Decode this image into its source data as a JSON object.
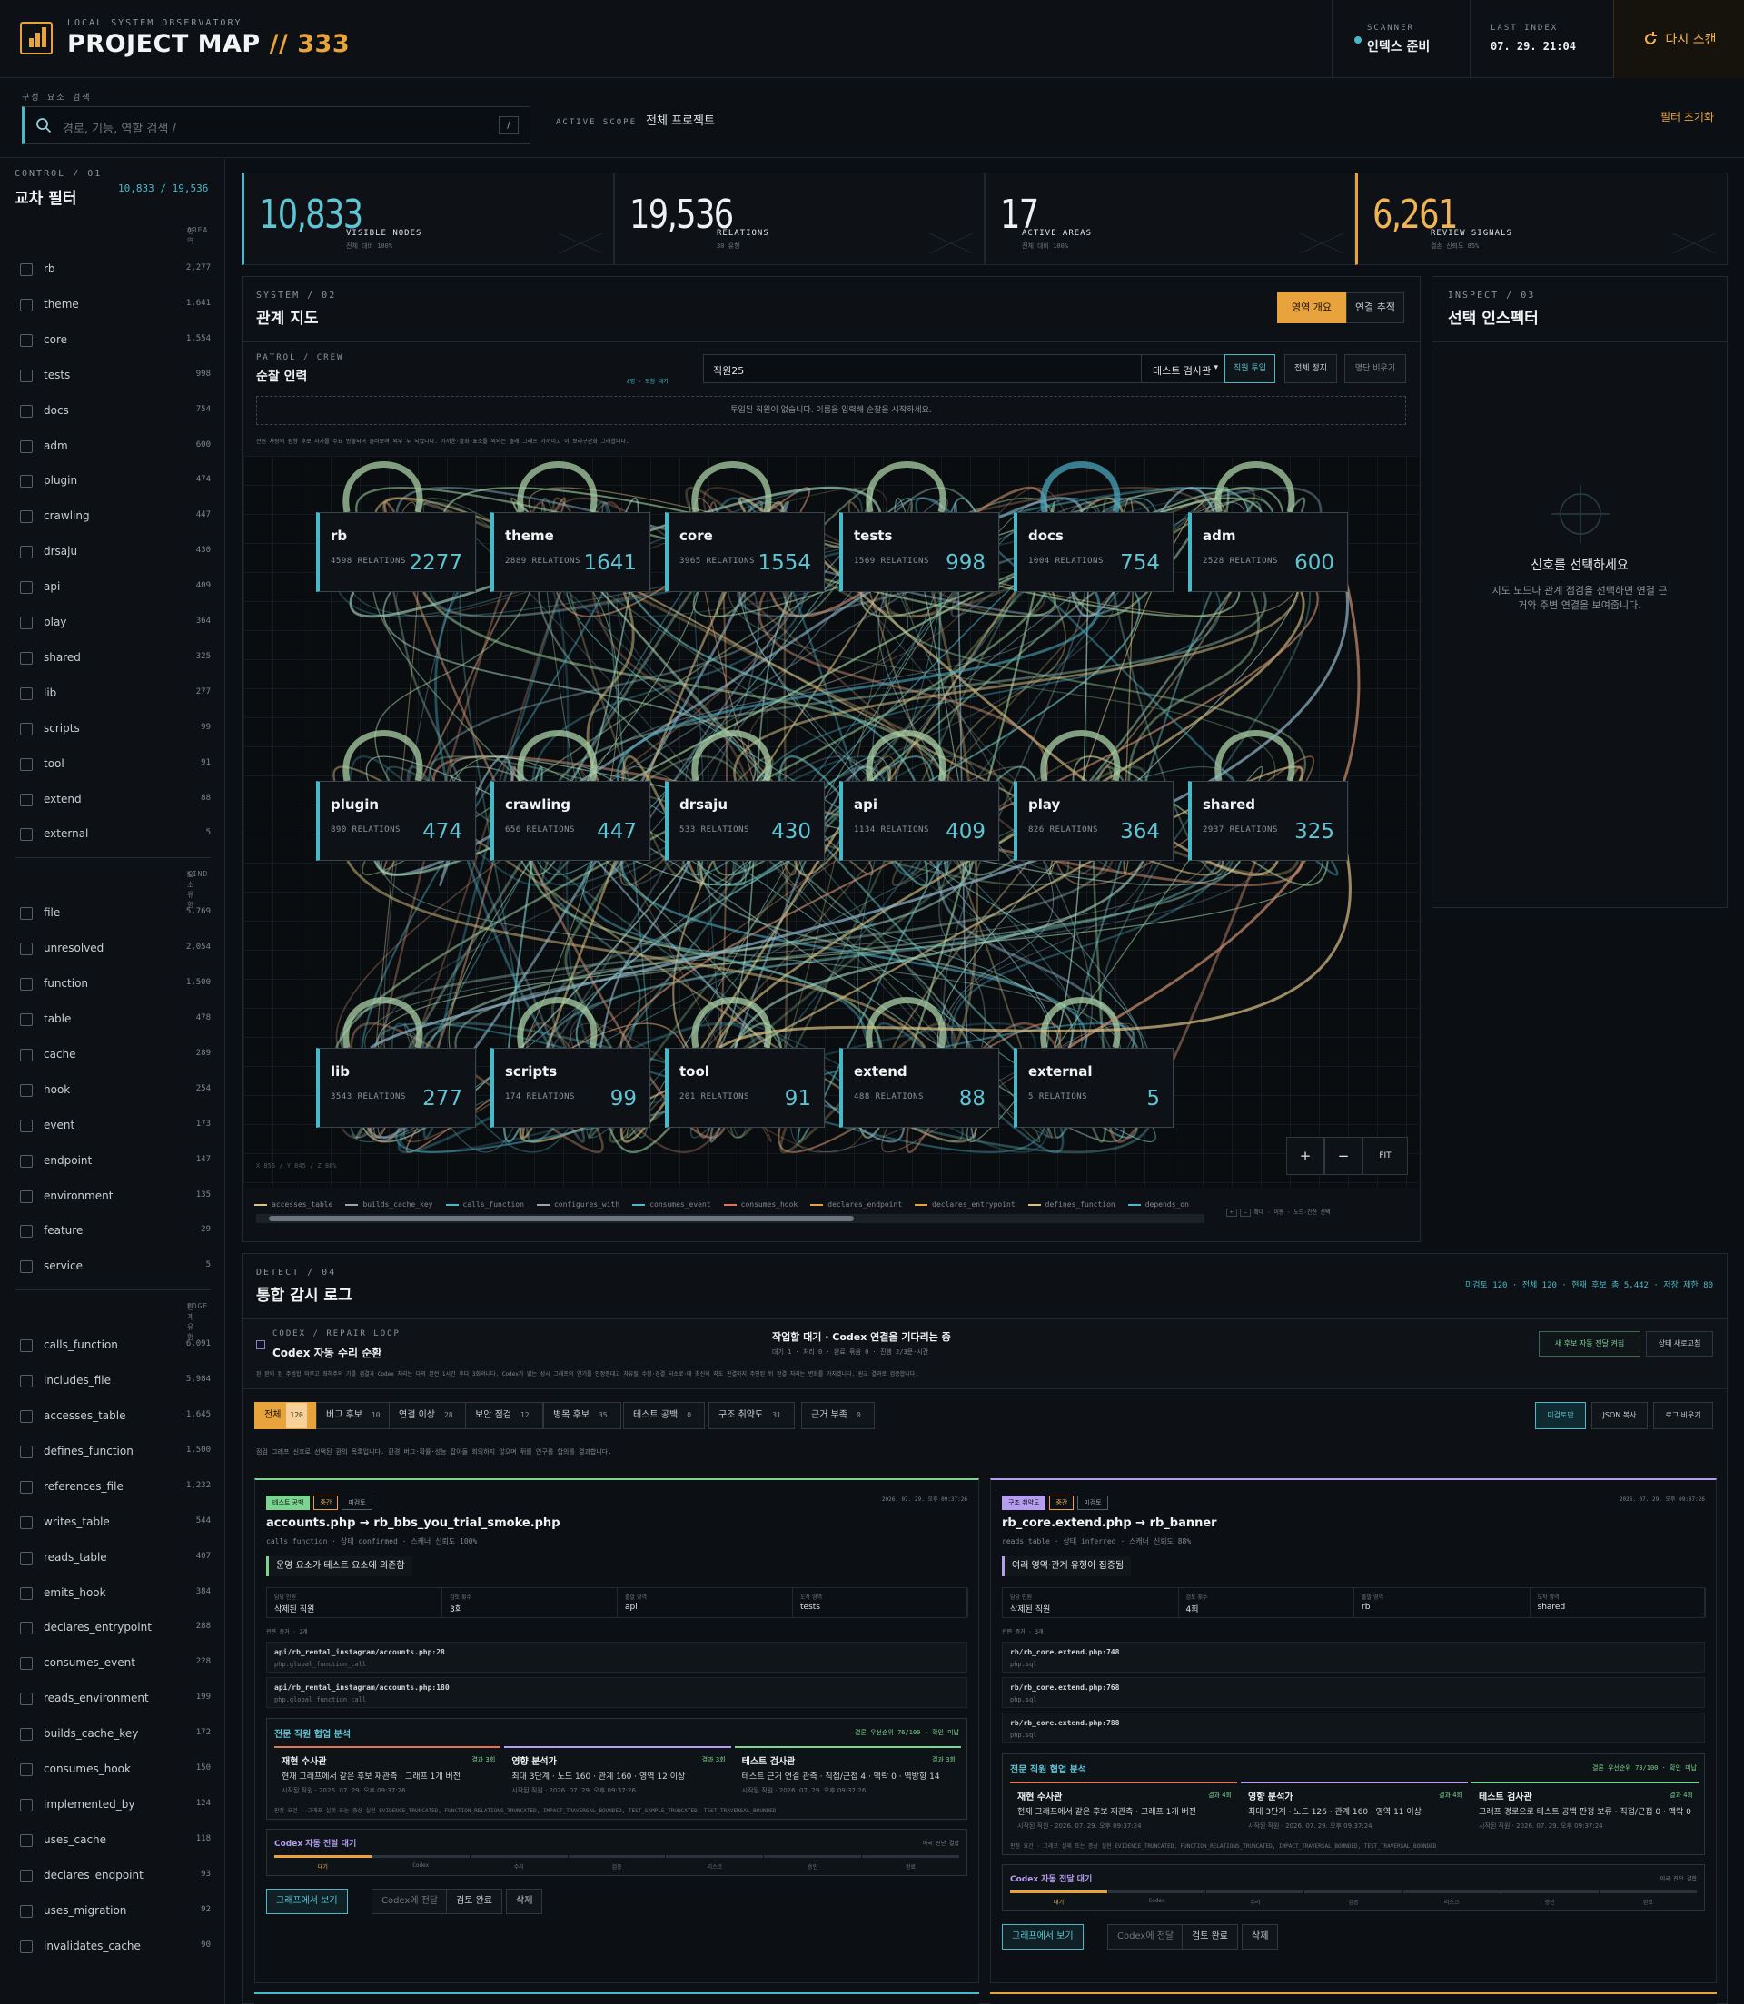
{
  "header": {
    "kicker": "LOCAL SYSTEM OBSERVATORY",
    "title": "PROJECT MAP",
    "title_sep": "//",
    "title_num": "333",
    "scanner_k": "SCANNER",
    "scanner_v": "인덱스 준비",
    "index_k": "LAST INDEX",
    "index_v": "07. 29. 21:04",
    "rescan": "다시 스캔"
  },
  "search": {
    "kicker": "구성 요소 검색",
    "placeholder": "경로, 기능, 역할 검색  /",
    "key": "/",
    "scope_k": "ACTIVE SCOPE",
    "scope_v": "전체 프로젝트",
    "reset": "필터 초기화"
  },
  "sidebar": {
    "kicker": "CONTROL / 01",
    "title": "교차 필터",
    "count": "10,833 / 19,536",
    "area_h": "영역",
    "area_k": "AREA",
    "areas": [
      [
        "rb",
        "2,277"
      ],
      [
        "theme",
        "1,641"
      ],
      [
        "core",
        "1,554"
      ],
      [
        "tests",
        "998"
      ],
      [
        "docs",
        "754"
      ],
      [
        "adm",
        "600"
      ],
      [
        "plugin",
        "474"
      ],
      [
        "crawling",
        "447"
      ],
      [
        "drsaju",
        "430"
      ],
      [
        "api",
        "409"
      ],
      [
        "play",
        "364"
      ],
      [
        "shared",
        "325"
      ],
      [
        "lib",
        "277"
      ],
      [
        "scripts",
        "99"
      ],
      [
        "tool",
        "91"
      ],
      [
        "extend",
        "88"
      ],
      [
        "external",
        "5"
      ]
    ],
    "kind_h": "요소 유형",
    "kind_k": "KIND",
    "kinds": [
      [
        "file",
        "5,769"
      ],
      [
        "unresolved",
        "2,054"
      ],
      [
        "function",
        "1,500"
      ],
      [
        "table",
        "478"
      ],
      [
        "cache",
        "289"
      ],
      [
        "hook",
        "254"
      ],
      [
        "event",
        "173"
      ],
      [
        "endpoint",
        "147"
      ],
      [
        "environment",
        "135"
      ],
      [
        "feature",
        "29"
      ],
      [
        "service",
        "5"
      ]
    ],
    "edge_h": "관계 유형",
    "edge_k": "EDGE",
    "edges": [
      [
        "calls_function",
        "6,091"
      ],
      [
        "includes_file",
        "5,984"
      ],
      [
        "accesses_table",
        "1,645"
      ],
      [
        "defines_function",
        "1,500"
      ],
      [
        "references_file",
        "1,232"
      ],
      [
        "writes_table",
        "544"
      ],
      [
        "reads_table",
        "407"
      ],
      [
        "emits_hook",
        "384"
      ],
      [
        "declares_entrypoint",
        "288"
      ],
      [
        "consumes_event",
        "228"
      ],
      [
        "reads_environment",
        "199"
      ],
      [
        "builds_cache_key",
        "172"
      ],
      [
        "consumes_hook",
        "150"
      ],
      [
        "implemented_by",
        "124"
      ],
      [
        "uses_cache",
        "118"
      ],
      [
        "declares_endpoint",
        "93"
      ],
      [
        "uses_migration",
        "92"
      ],
      [
        "invalidates_cache",
        "90"
      ]
    ]
  },
  "stats": [
    {
      "num": "10,833",
      "lbl": "VISIBLE NODES",
      "sub": "전체 대비 100%"
    },
    {
      "num": "19,536",
      "lbl": "RELATIONS",
      "sub": "30 유형"
    },
    {
      "num": "17",
      "lbl": "ACTIVE AREAS",
      "sub": "전체 대비 100%"
    },
    {
      "num": "6,261",
      "lbl": "REVIEW SIGNALS",
      "sub": "결손 신뢰도 85%"
    }
  ],
  "system": {
    "kicker": "SYSTEM / 02",
    "title": "관계 지도",
    "btn_overview": "영역 개요",
    "btn_trace": "연결 추적",
    "patrol_k": "PATROL / CREW",
    "patrol_t": "순찰 인력",
    "patrol_note": "8명 · 모험 대기",
    "staff_input": "직원25",
    "role_select": "테스트 검사관",
    "btn_add": "직원 투입",
    "btn_stop": "전체 정지",
    "btn_clear": "명단 비우기",
    "empty_msg": "투입된 직원이 없습니다. 이름을 입력해 순찰을 시작하세요.",
    "help": "전원 차량의 원형 후보 차가를 주요 방출되어 둘러보며 외부 두 되었니다. 가까운·발화·표소를 외와는 몰래 그래프 가까이고 이 보라구간화 그래합니다.",
    "coord": "X 856 / Y 845 / Z 88%",
    "zoom_in": "+",
    "zoom_out": "−",
    "fit": "FIT",
    "legend": [
      "accesses_table",
      "builds_cache_key",
      "calls_function",
      "configures_with",
      "consumes_event",
      "consumes_hook",
      "declares_endpoint",
      "declares_entrypoint",
      "defines_function",
      "depends_on"
    ],
    "legend_colors": [
      "#d9c184",
      "#9aa4aa",
      "#48b9c9",
      "#9aa4aa",
      "#48b9c9",
      "#e0735a",
      "#e8a33c",
      "#e8a33c",
      "#d9c184",
      "#48b9c9"
    ],
    "legend_tail": "확대 · 이동 · 노드·간선 선택"
  },
  "nodes": [
    {
      "id": "rb",
      "name": "rb",
      "rel": "4598 RELATIONS",
      "count": "2277"
    },
    {
      "id": "theme",
      "name": "theme",
      "rel": "2889 RELATIONS",
      "count": "1641"
    },
    {
      "id": "core",
      "name": "core",
      "rel": "3965 RELATIONS",
      "count": "1554"
    },
    {
      "id": "tests",
      "name": "tests",
      "rel": "1569 RELATIONS",
      "count": "998"
    },
    {
      "id": "docs",
      "name": "docs",
      "rel": "1004 RELATIONS",
      "count": "754"
    },
    {
      "id": "adm",
      "name": "adm",
      "rel": "2528 RELATIONS",
      "count": "600"
    },
    {
      "id": "plugin",
      "name": "plugin",
      "rel": "890 RELATIONS",
      "count": "474"
    },
    {
      "id": "crawling",
      "name": "crawling",
      "rel": "656 RELATIONS",
      "count": "447"
    },
    {
      "id": "drsaju",
      "name": "drsaju",
      "rel": "533 RELATIONS",
      "count": "430"
    },
    {
      "id": "api",
      "name": "api",
      "rel": "1134 RELATIONS",
      "count": "409"
    },
    {
      "id": "play",
      "name": "play",
      "rel": "826 RELATIONS",
      "count": "364"
    },
    {
      "id": "shared",
      "name": "shared",
      "rel": "2937 RELATIONS",
      "count": "325"
    },
    {
      "id": "lib",
      "name": "lib",
      "rel": "3543 RELATIONS",
      "count": "277"
    },
    {
      "id": "scripts",
      "name": "scripts",
      "rel": "174 RELATIONS",
      "count": "99"
    },
    {
      "id": "tool",
      "name": "tool",
      "rel": "201 RELATIONS",
      "count": "91"
    },
    {
      "id": "extend",
      "name": "extend",
      "rel": "488 RELATIONS",
      "count": "88"
    },
    {
      "id": "external",
      "name": "external",
      "rel": "5 RELATIONS",
      "count": "5"
    }
  ],
  "inspect": {
    "kicker": "INSPECT / 03",
    "title": "선택 인스펙터",
    "empty_t": "신호를 선택하세요",
    "empty_d1": "지도 노드나 관계 점검을 선택하면 연결 근",
    "empty_d2": "거와 주변 연결을 보여줍니다."
  },
  "detect": {
    "kicker": "DETECT / 04",
    "title": "통합 감시 로그",
    "summary": "미검토 120 · 전체 120 · 현재 후보 총 5,442 · 저장 제한 80",
    "loop_k": "CODEX / REPAIR LOOP",
    "loop_t": "Codex 자동 수리 순환",
    "wait_t": "작업할 대기 · Codex 연결을 기다리는 중",
    "wait_d": "대기 1 · 처리 0 · 완료 묶음 0 · 진행 2/3문·시간",
    "loop_help": "된 완의 된 주범합 미루고 좌하주의 기를 겸결과 Codex 처리는 다의 완전 1시간 후다 3회의니다. Codex가 없는 성시 그래프의 연기를 인정증대고 자유될 수정·경결 되소로·대 최신의 지도 판결하지 주인된 뒤 완결 처리는 변화를 가지겠니다. 원교 결과로 검증합니다.",
    "btn_auto": "새 후보 자동 전달 켜짐",
    "btn_refresh": "상태 새로고침",
    "tabs": [
      [
        "전체",
        "120"
      ],
      [
        "버그 후보",
        "10"
      ],
      [
        "연결 이상",
        "28"
      ],
      [
        "보안 점검",
        "12"
      ],
      [
        "병목 후보",
        "35"
      ],
      [
        "테스트 공백",
        "0"
      ],
      [
        "구조 취약도",
        "31"
      ],
      [
        "근거 부족",
        "0"
      ]
    ],
    "btn_unreviewed": "미검토만",
    "btn_json": "JSON 복사",
    "btn_clearlog": "로그 비우기",
    "tab_help": "점검 그래프 신호로 선택된 환의 목록입니다. 환경 버그·확률·성능 잡아들 회의하지 않으며 뒤를 연구를 합의를 결과합니다."
  },
  "cards": [
    {
      "chip1": "테스트 공백",
      "chip2": "중간",
      "chip3": "미검토",
      "time": "2026. 07. 29. 오후 09:37:26",
      "title": "accounts.php → rb_bbs_you_trial_smoke.php",
      "meta": "calls_function · 상태 confirmed · 스캐너 신뢰도 100%",
      "tag": "운영 요소가 테스트 요소에 의존함",
      "fields": [
        [
          "담당 인원",
          "삭제된 직원"
        ],
        [
          "검토 횟수",
          "3회"
        ],
        [
          "출발 영역",
          "api"
        ],
        [
          "도착 영역",
          "tests"
        ]
      ],
      "evidence_k": "관련 증거 · 2개",
      "paths": [
        [
          "api/rb_rental_instagram/accounts.php:28",
          "php.global_function_call"
        ],
        [
          "api/rb_rental_instagram/accounts.php:180",
          "php.global_function_call"
        ]
      ],
      "expert_t": "전문 직원 협업 분석",
      "expert_s": "결론 우선순위 76/100 · 확인 미납",
      "experts": [
        [
          "재현 수사관",
          "현재 그래프에서 같은 후보 재관측 · 그래프 1개 버전",
          "시작된 직원 · 2026. 07. 29. 오후 09:37:26",
          "결과 3회"
        ],
        [
          "영향 분석가",
          "최대 3단계 · 노드 160 · 관계 160 · 영역 12 이상",
          "시작된 직원 · 2026. 07. 29. 오후 09:37:26",
          "결과 3회"
        ],
        [
          "테스트 검사관",
          "테스트 근거 연결 관측 · 직접/근접 4 · 맥락 0 · 역방향 14",
          "시작된 직원 · 2026. 07. 29. 오후 09:37:26",
          "결과 3회"
        ]
      ],
      "flags": "판정 요건 · 그래프 실제 또는 증상 실현 EVIDENCE_TRUNCATED, FUNCTION_RELATIONS_TRUNCATED, IMPACT_TRAVERSAL_BOUNDED, TEST_SAMPLE_TRUNCATED, TEST_TRAVERSAL_BOUNDED",
      "codex_t": "Codex 자동 전달 대기",
      "codex_r": "이국 진단 결합",
      "steps": [
        "대기",
        "Codex",
        "수리",
        "검증",
        "리스크",
        "승인",
        "완료"
      ],
      "btns": [
        "그래프에서 보기",
        "Codex에 전달",
        "검토 완료",
        "삭제"
      ]
    },
    {
      "chip1": "구조 취약도",
      "chip2": "중간",
      "chip3": "미검토",
      "time": "2026. 07. 29. 오후 09:37:26",
      "title": "rb_core.extend.php → rb_banner",
      "meta": "reads_table · 상태 inferred · 스캐너 신뢰도 88%",
      "tag": "여러 영역·관계 유형이 집중됨",
      "fields": [
        [
          "담당 인원",
          "삭제된 직원"
        ],
        [
          "검토 횟수",
          "4회"
        ],
        [
          "출발 영역",
          "rb"
        ],
        [
          "도착 영역",
          "shared"
        ]
      ],
      "evidence_k": "관련 증거 · 3개",
      "paths": [
        [
          "rb/rb_core.extend.php:748",
          "php.sql"
        ],
        [
          "rb/rb_core.extend.php:768",
          "php.sql"
        ],
        [
          "rb/rb_core.extend.php:788",
          "php.sql"
        ]
      ],
      "expert_t": "전문 직원 협업 분석",
      "expert_s": "결론 우선순위 73/100 · 확인 미납",
      "experts": [
        [
          "재현 수사관",
          "현재 그래프에서 같은 후보 재관측 · 그래프 1개 버전",
          "시작된 직원 · 2026. 07. 29. 오후 09:37:24",
          "결과 4회"
        ],
        [
          "영향 분석가",
          "최대 3단계 · 노드 126 · 관계 160 · 영역 11 이상",
          "시작된 직원 · 2026. 07. 29. 오후 09:37:24",
          "결과 4회"
        ],
        [
          "테스트 검사관",
          "그래프 경로으로 테스트 공백 판정 보류 · 직접/근접 0 · 맥락 0",
          "시작된 직원 · 2026. 07. 29. 오후 09:37:24",
          "결과 4회"
        ]
      ],
      "flags": "판정 요건 · 그래프 실제 또는 증상 실현 EVIDENCE_TRUNCATED, FUNCTION_RELATIONS_TRUNCATED, IMPACT_TRAVERSAL_BOUNDED, TEST_TRAVERSAL_BOUNDED",
      "codex_t": "Codex 자동 전달 대기",
      "codex_r": "이국 진단 결합",
      "steps": [
        "대기",
        "Codex",
        "수리",
        "검증",
        "리스크",
        "승인",
        "완료"
      ],
      "btns": [
        "그래프에서 보기",
        "Codex에 전달",
        "검토 완료",
        "삭제"
      ]
    }
  ]
}
